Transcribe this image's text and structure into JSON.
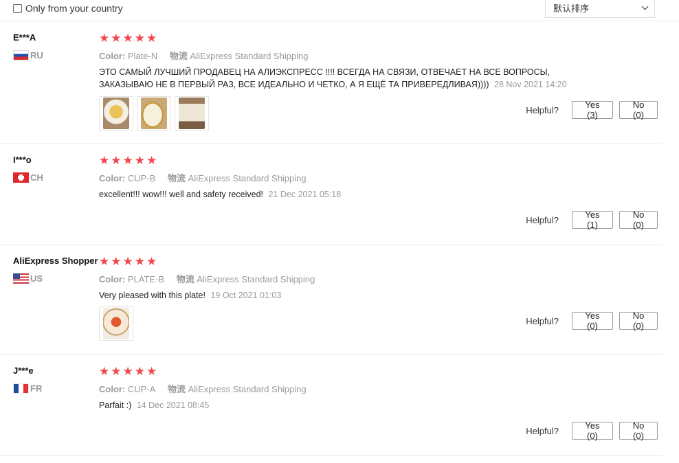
{
  "filter": {
    "only_country_label": "Only from your country",
    "sort_value": "默认排序"
  },
  "helpful_label": "Helpful?",
  "reviews": [
    {
      "user": "E***A",
      "country": "RU",
      "flag": "flag-ru",
      "rating": 5,
      "color_label": "Color:",
      "color_value": "Plate-N",
      "shipping_label": "物流",
      "shipping_value": "AliExpress Standard Shipping",
      "text": "ЭТО САМЫЙ ЛУЧШИЙ ПРОДАВЕЦ НА АЛИЭКСПРЕСС !!!! ВСЕГДА НА СВЯЗИ, ОТВЕЧАЕТ НА ВСЕ ВОПРОСЫ, ЗАКАЗЫВАЮ НЕ В ПЕРВЫЙ РАЗ, ВСЕ ИДЕАЛЬНО И ЧЕТКО, А Я ЕЩЁ ТА ПРИВЕРЕДЛИВАЯ))))",
      "date": "28 Nov 2021 14:20",
      "photo_count": 3,
      "yes": "Yes (3)",
      "no": "No (0)"
    },
    {
      "user": "I***o",
      "country": "CH",
      "flag": "flag-ch",
      "rating": 5,
      "color_label": "Color:",
      "color_value": "CUP-B",
      "shipping_label": "物流",
      "shipping_value": "AliExpress Standard Shipping",
      "text": "excellent!!! wow!!! well and safety received!",
      "date": "21 Dec 2021 05:18",
      "photo_count": 0,
      "yes": "Yes (1)",
      "no": "No (0)"
    },
    {
      "user": "AliExpress Shopper",
      "country": "US",
      "flag": "flag-us",
      "rating": 5,
      "color_label": "Color:",
      "color_value": "PLATE-B",
      "shipping_label": "物流",
      "shipping_value": "AliExpress Standard Shipping",
      "text": "Very pleased with this plate!",
      "date": "19 Oct 2021 01:03",
      "photo_count": 1,
      "yes": "Yes (0)",
      "no": "No (0)"
    },
    {
      "user": "J***e",
      "country": "FR",
      "flag": "flag-fr",
      "rating": 5,
      "color_label": "Color:",
      "color_value": "CUP-A",
      "shipping_label": "物流",
      "shipping_value": "AliExpress Standard Shipping",
      "text": "Parfait :)",
      "date": "14 Dec 2021 08:45",
      "photo_count": 0,
      "yes": "Yes (0)",
      "no": "No (0)"
    }
  ],
  "colors": {
    "star": "#f2484d",
    "muted": "#999999",
    "border": "#e8e8e8"
  },
  "icons": {
    "star": "star-icon",
    "chevron": "chevron-down-icon"
  }
}
